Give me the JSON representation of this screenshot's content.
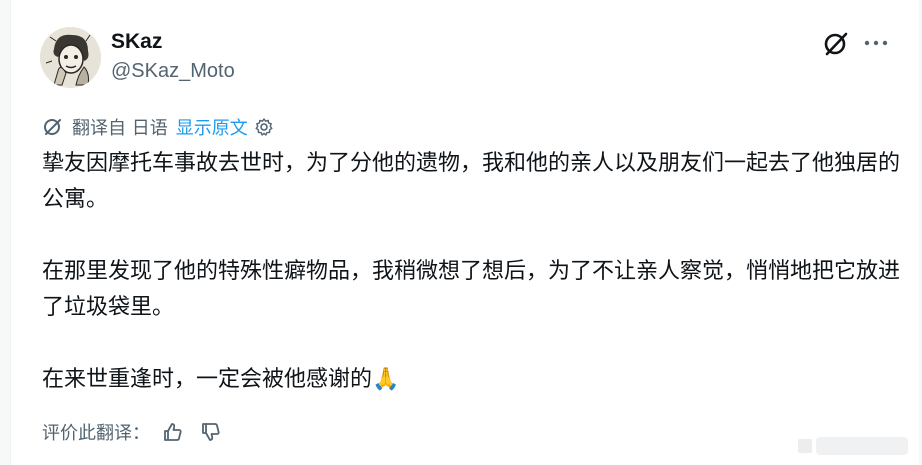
{
  "author": {
    "display_name": "SKaz",
    "handle": "@SKaz_Moto"
  },
  "translation": {
    "translated_from": "翻译自 日语",
    "show_original": "显示原文"
  },
  "post": {
    "paragraphs": [
      "挚友因摩托车事故去世时，为了分他的遗物，我和他的亲人以及朋友们一起去了他独居的公寓。",
      "在那里发现了他的特殊性癖物品，我稍微想了想后，为了不让亲人察觉，悄悄地把它放进了垃圾袋里。",
      "在来世重逢时，一定会被他感谢的🙏"
    ]
  },
  "rate": {
    "label": "评价此翻译："
  },
  "icons": {
    "grok": "grok-icon",
    "more": "more-icon",
    "translate": "translate-icon",
    "settings": "gear-icon",
    "like": "thumbs-up-icon",
    "dislike": "thumbs-down-icon"
  },
  "colors": {
    "link": "#1d9bf0",
    "text": "#0f1419",
    "secondary": "#536471"
  }
}
